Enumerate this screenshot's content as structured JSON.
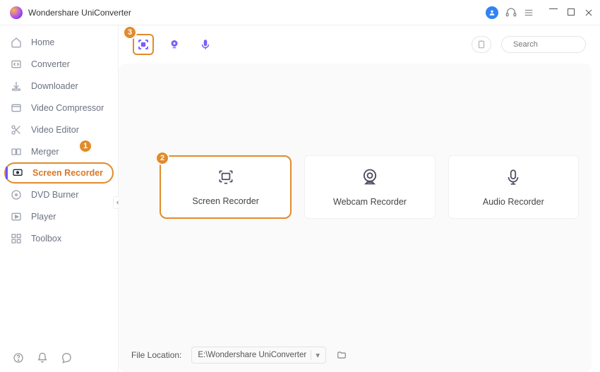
{
  "app": {
    "title": "Wondershare UniConverter"
  },
  "sidebar": {
    "items": [
      {
        "label": "Home"
      },
      {
        "label": "Converter"
      },
      {
        "label": "Downloader"
      },
      {
        "label": "Video Compressor"
      },
      {
        "label": "Video Editor"
      },
      {
        "label": "Merger"
      },
      {
        "label": "Screen Recorder"
      },
      {
        "label": "DVD Burner"
      },
      {
        "label": "Player"
      },
      {
        "label": "Toolbox"
      }
    ]
  },
  "callouts": {
    "one": "1",
    "two": "2",
    "three": "3"
  },
  "search": {
    "placeholder": "Search"
  },
  "cards": [
    {
      "label": "Screen Recorder"
    },
    {
      "label": "Webcam Recorder"
    },
    {
      "label": "Audio Recorder"
    }
  ],
  "footer": {
    "label": "File Location:",
    "path": "E:\\Wondershare UniConverter"
  }
}
